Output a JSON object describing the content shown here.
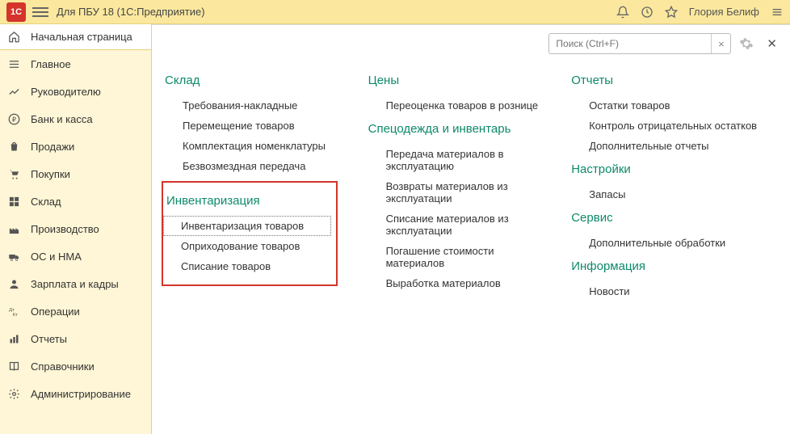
{
  "titlebar": {
    "title": "Для ПБУ 18  (1С:Предприятие)",
    "username": "Глория Белиф"
  },
  "home_label": "Начальная страница",
  "sidebar": {
    "items": [
      {
        "label": "Главное",
        "icon": "menu"
      },
      {
        "label": "Руководителю",
        "icon": "chart"
      },
      {
        "label": "Банк и касса",
        "icon": "ruble"
      },
      {
        "label": "Продажи",
        "icon": "bag"
      },
      {
        "label": "Покупки",
        "icon": "cart"
      },
      {
        "label": "Склад",
        "icon": "boxes"
      },
      {
        "label": "Производство",
        "icon": "factory"
      },
      {
        "label": "ОС и НМА",
        "icon": "truck"
      },
      {
        "label": "Зарплата и кадры",
        "icon": "person"
      },
      {
        "label": "Операции",
        "icon": "dtkt"
      },
      {
        "label": "Отчеты",
        "icon": "bars"
      },
      {
        "label": "Справочники",
        "icon": "book"
      },
      {
        "label": "Администрирование",
        "icon": "gear"
      }
    ]
  },
  "search": {
    "placeholder": "Поиск (Ctrl+F)"
  },
  "columns": {
    "col1": {
      "sections": [
        {
          "title": "Склад",
          "items": [
            "Требования-накладные",
            "Перемещение товаров",
            "Комплектация номенклатуры",
            "Безвозмездная передача"
          ]
        },
        {
          "title": "Инвентаризация",
          "highlighted": true,
          "items": [
            "Инвентаризация товаров",
            "Оприходование товаров",
            "Списание товаров"
          ],
          "selected": 0
        }
      ]
    },
    "col2": {
      "sections": [
        {
          "title": "Цены",
          "items": [
            "Переоценка товаров в рознице"
          ]
        },
        {
          "title": "Спецодежда и инвентарь",
          "items": [
            "Передача материалов в эксплуатацию",
            "Возвраты материалов из эксплуатации",
            "Списание материалов из эксплуатации",
            "Погашение стоимости материалов",
            "Выработка материалов"
          ]
        }
      ]
    },
    "col3": {
      "sections": [
        {
          "title": "Отчеты",
          "items": [
            "Остатки товаров",
            "Контроль отрицательных остатков",
            "Дополнительные отчеты"
          ]
        },
        {
          "title": "Настройки",
          "items": [
            "Запасы"
          ]
        },
        {
          "title": "Сервис",
          "items": [
            "Дополнительные обработки"
          ]
        },
        {
          "title": "Информация",
          "items": [
            "Новости"
          ]
        }
      ]
    }
  }
}
